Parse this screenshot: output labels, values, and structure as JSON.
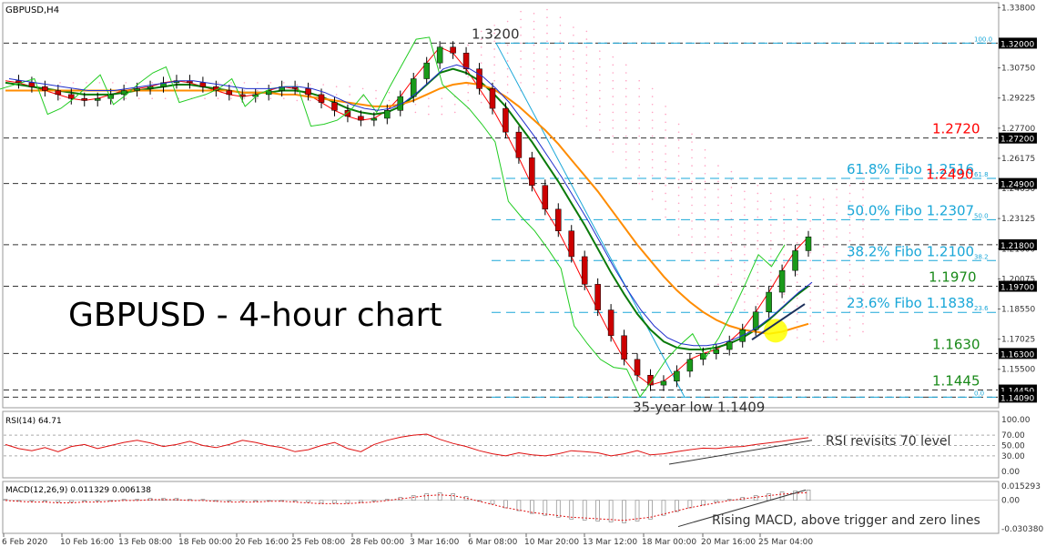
{
  "window": {
    "symbol_label": "GBPUSD,H4"
  },
  "chart_data": [
    {
      "type": "line",
      "panel": "price",
      "title": "GBPUSD - 4-hour chart",
      "ylim": [
        1.136,
        1.34
      ],
      "grid": false,
      "price_axis_ticks": [
        "1.33800",
        "1.30750",
        "1.29225",
        "1.27700",
        "1.26175",
        "1.24650",
        "1.23125",
        "1.21600",
        "1.20075",
        "1.18550",
        "1.17025",
        "1.15500"
      ],
      "level_markers": [
        {
          "label": "1.32000",
          "value": 1.32
        },
        {
          "label": "1.27200",
          "value": 1.272
        },
        {
          "label": "1.24900",
          "value": 1.249
        },
        {
          "label": "1.21800",
          "value": 1.218
        },
        {
          "label": "1.19700",
          "value": 1.197
        },
        {
          "label": "1.16300",
          "value": 1.163
        },
        {
          "label": "1.14450",
          "value": 1.1445
        },
        {
          "label": "1.14090",
          "value": 1.1409
        }
      ],
      "fib_tags": [
        {
          "label": "100.0",
          "value": 1.32
        },
        {
          "label": "61.8",
          "value": 1.2516
        },
        {
          "label": "50.0",
          "value": 1.2307
        },
        {
          "label": "38.2",
          "value": 1.21
        },
        {
          "label": "23.6",
          "value": 1.1838
        },
        {
          "label": "0.0",
          "value": 1.1409
        }
      ],
      "annotations": [
        {
          "text": "1.3200",
          "value": 1.32,
          "color": "#333333"
        },
        {
          "text": "1.2720",
          "value": 1.272,
          "color": "#ff0000"
        },
        {
          "text": "61.8% Fibo 1.2516",
          "value": 1.2516,
          "color": "#1aa7d8"
        },
        {
          "text": "1.2490",
          "value": 1.249,
          "color": "#ff0000"
        },
        {
          "text": "50.0% Fibo 1.2307",
          "value": 1.2307,
          "color": "#1aa7d8"
        },
        {
          "text": "38.2% Fibo 1.2100",
          "value": 1.21,
          "color": "#1aa7d8"
        },
        {
          "text": "1.1970",
          "value": 1.197,
          "color": "#1a8a1a"
        },
        {
          "text": "23.6% Fibo 1.1838",
          "value": 1.1838,
          "color": "#1aa7d8"
        },
        {
          "text": "1.1630",
          "value": 1.163,
          "color": "#1a8a1a"
        },
        {
          "text": "1.1445",
          "value": 1.1445,
          "color": "#1a8a1a"
        },
        {
          "text": "35-year low 1.1409",
          "value": 1.1409,
          "color": "#333333"
        }
      ],
      "x_axis_labels": [
        "6 Feb 2020",
        "10 Feb 16:00",
        "13 Feb 08:00",
        "18 Feb 00:00",
        "20 Feb 16:00",
        "25 Feb 08:00",
        "28 Feb 00:00",
        "3 Mar 16:00",
        "6 Mar 08:00",
        "10 Mar 20:00",
        "13 Mar 12:00",
        "18 Mar 00:00",
        "20 Mar 16:00",
        "25 Mar 04:00"
      ],
      "series": [
        {
          "values": [
            1.301,
            1.3,
            1.298,
            1.296,
            1.294,
            1.292,
            1.291,
            1.292,
            1.294,
            1.296,
            1.297,
            1.298,
            1.3,
            1.301,
            1.3,
            1.298,
            1.296,
            1.294,
            1.293,
            1.294,
            1.296,
            1.298,
            1.297,
            1.294,
            1.29,
            1.286,
            1.283,
            1.281,
            1.282,
            1.286,
            1.293,
            1.302,
            1.31,
            1.318,
            1.315,
            1.307,
            1.297,
            1.287,
            1.275,
            1.262,
            1.248,
            1.236,
            1.225,
            1.212,
            1.198,
            1.185,
            1.172,
            1.16,
            1.152,
            1.147,
            1.149,
            1.154,
            1.16,
            1.163,
            1.165,
            1.169,
            1.175,
            1.184,
            1.194,
            1.205,
            1.215,
            1.222
          ]
        },
        {
          "values": [
            1.3,
            1.299,
            1.298,
            1.297,
            1.296,
            1.295,
            1.294,
            1.294,
            1.294,
            1.295,
            1.296,
            1.297,
            1.298,
            1.299,
            1.299,
            1.298,
            1.297,
            1.296,
            1.295,
            1.295,
            1.295,
            1.296,
            1.296,
            1.295,
            1.293,
            1.29,
            1.287,
            1.285,
            1.284,
            1.285,
            1.288,
            1.293,
            1.299,
            1.305,
            1.307,
            1.305,
            1.301,
            1.295,
            1.288,
            1.279,
            1.27,
            1.26,
            1.25,
            1.239,
            1.228,
            1.216,
            1.204,
            1.193,
            1.183,
            1.175,
            1.169,
            1.166,
            1.165,
            1.165,
            1.166,
            1.168,
            1.171,
            1.175,
            1.18,
            1.186,
            1.192,
            1.197
          ]
        },
        {
          "values": [
            1.296,
            1.296,
            1.296,
            1.296,
            1.296,
            1.296,
            1.296,
            1.296,
            1.296,
            1.296,
            1.296,
            1.296,
            1.296,
            1.296,
            1.296,
            1.296,
            1.296,
            1.296,
            1.295,
            1.295,
            1.295,
            1.294,
            1.294,
            1.293,
            1.292,
            1.291,
            1.29,
            1.289,
            1.288,
            1.288,
            1.289,
            1.291,
            1.294,
            1.297,
            1.299,
            1.3,
            1.299,
            1.297,
            1.293,
            1.288,
            1.282,
            1.276,
            1.269,
            1.261,
            1.253,
            1.245,
            1.236,
            1.227,
            1.218,
            1.21,
            1.202,
            1.195,
            1.189,
            1.184,
            1.18,
            1.177,
            1.175,
            1.174,
            1.173,
            1.174,
            1.176,
            1.178
          ]
        }
      ]
    },
    {
      "type": "line",
      "panel": "rsi",
      "title": "RSI(14) 64.71",
      "ylim": [
        0,
        100
      ],
      "ticks": [
        "100.00",
        "70.00",
        "50.00",
        "30.00",
        "0.00"
      ],
      "levels": [
        70,
        50,
        30
      ],
      "annotation": "RSI revisits 70 level",
      "series": [
        {
          "values": [
            52,
            44,
            40,
            46,
            38,
            48,
            52,
            44,
            50,
            56,
            60,
            55,
            48,
            52,
            58,
            50,
            46,
            52,
            60,
            56,
            50,
            46,
            38,
            42,
            50,
            56,
            44,
            38,
            52,
            60,
            66,
            70,
            72,
            62,
            54,
            48,
            40,
            34,
            30,
            36,
            32,
            30,
            34,
            40,
            38,
            36,
            30,
            34,
            40,
            32,
            34,
            38,
            42,
            45,
            44,
            47,
            48,
            52,
            55,
            58,
            62,
            65
          ]
        }
      ]
    },
    {
      "type": "bar",
      "panel": "macd",
      "title": "MACD(12,26,9) 0.011329 0.006138",
      "ylim": [
        -0.03038,
        0.015293
      ],
      "ticks": [
        "0.015293",
        "0.00",
        "-0.030380"
      ],
      "annotation": "Rising MACD, above trigger and zero lines",
      "values": [
        0.001,
        0.0,
        -0.001,
        -0.001,
        -0.002,
        -0.002,
        -0.001,
        -0.001,
        0.0,
        0.001,
        0.001,
        0.002,
        0.002,
        0.002,
        0.001,
        0.001,
        0.0,
        -0.001,
        -0.001,
        -0.001,
        0.0,
        0.0,
        -0.001,
        -0.002,
        -0.003,
        -0.003,
        -0.003,
        -0.002,
        -0.001,
        0.001,
        0.003,
        0.005,
        0.007,
        0.008,
        0.007,
        0.004,
        0.0,
        -0.004,
        -0.008,
        -0.011,
        -0.014,
        -0.016,
        -0.018,
        -0.02,
        -0.021,
        -0.022,
        -0.023,
        -0.024,
        -0.022,
        -0.02,
        -0.016,
        -0.012,
        -0.008,
        -0.005,
        -0.002,
        0.001,
        0.003,
        0.005,
        0.007,
        0.009,
        0.01,
        0.011
      ]
    }
  ]
}
